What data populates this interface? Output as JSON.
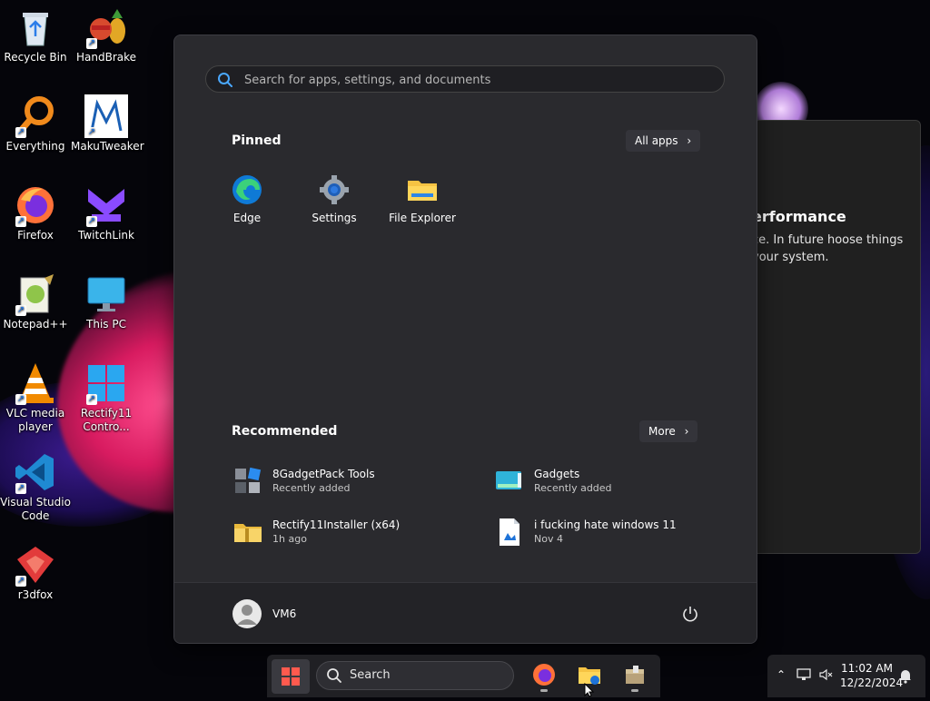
{
  "desktop": {
    "icons": [
      {
        "label": "Recycle Bin"
      },
      {
        "label": "HandBrake"
      },
      {
        "label": "Everything"
      },
      {
        "label": "MakuTweaker"
      },
      {
        "label": "Firefox"
      },
      {
        "label": "TwitchLink"
      },
      {
        "label": "Notepad++"
      },
      {
        "label": "This PC"
      },
      {
        "label": "VLC media player"
      },
      {
        "label": "Rectify11 Contro..."
      },
      {
        "label": "Visual Studio Code"
      },
      {
        "label": "r3dfox"
      }
    ]
  },
  "background_window": {
    "title": "erformance",
    "text": "ce. In future hoose things your system."
  },
  "start_menu": {
    "search_placeholder": "Search for apps, settings, and documents",
    "pinned_title": "Pinned",
    "all_apps_label": "All apps",
    "pinned": [
      {
        "label": "Edge",
        "icon": "edge-icon"
      },
      {
        "label": "Settings",
        "icon": "settings-gear-icon"
      },
      {
        "label": "File Explorer",
        "icon": "folder-icon"
      }
    ],
    "recommended_title": "Recommended",
    "more_label": "More",
    "recommended": [
      {
        "name": "8GadgetPack Tools",
        "sub": "Recently added"
      },
      {
        "name": "Gadgets",
        "sub": "Recently added"
      },
      {
        "name": "Rectify11Installer (x64)",
        "sub": "1h ago"
      },
      {
        "name": "i fucking hate windows 11",
        "sub": "Nov 4"
      }
    ],
    "user_name": "VM6"
  },
  "taskbar": {
    "search_label": "Search",
    "time": "11:02 AM",
    "date": "12/22/2024"
  },
  "colors": {
    "accent": "#0078d4",
    "start_bg": "#2a2a2e",
    "taskbar_bg": "#202024"
  }
}
